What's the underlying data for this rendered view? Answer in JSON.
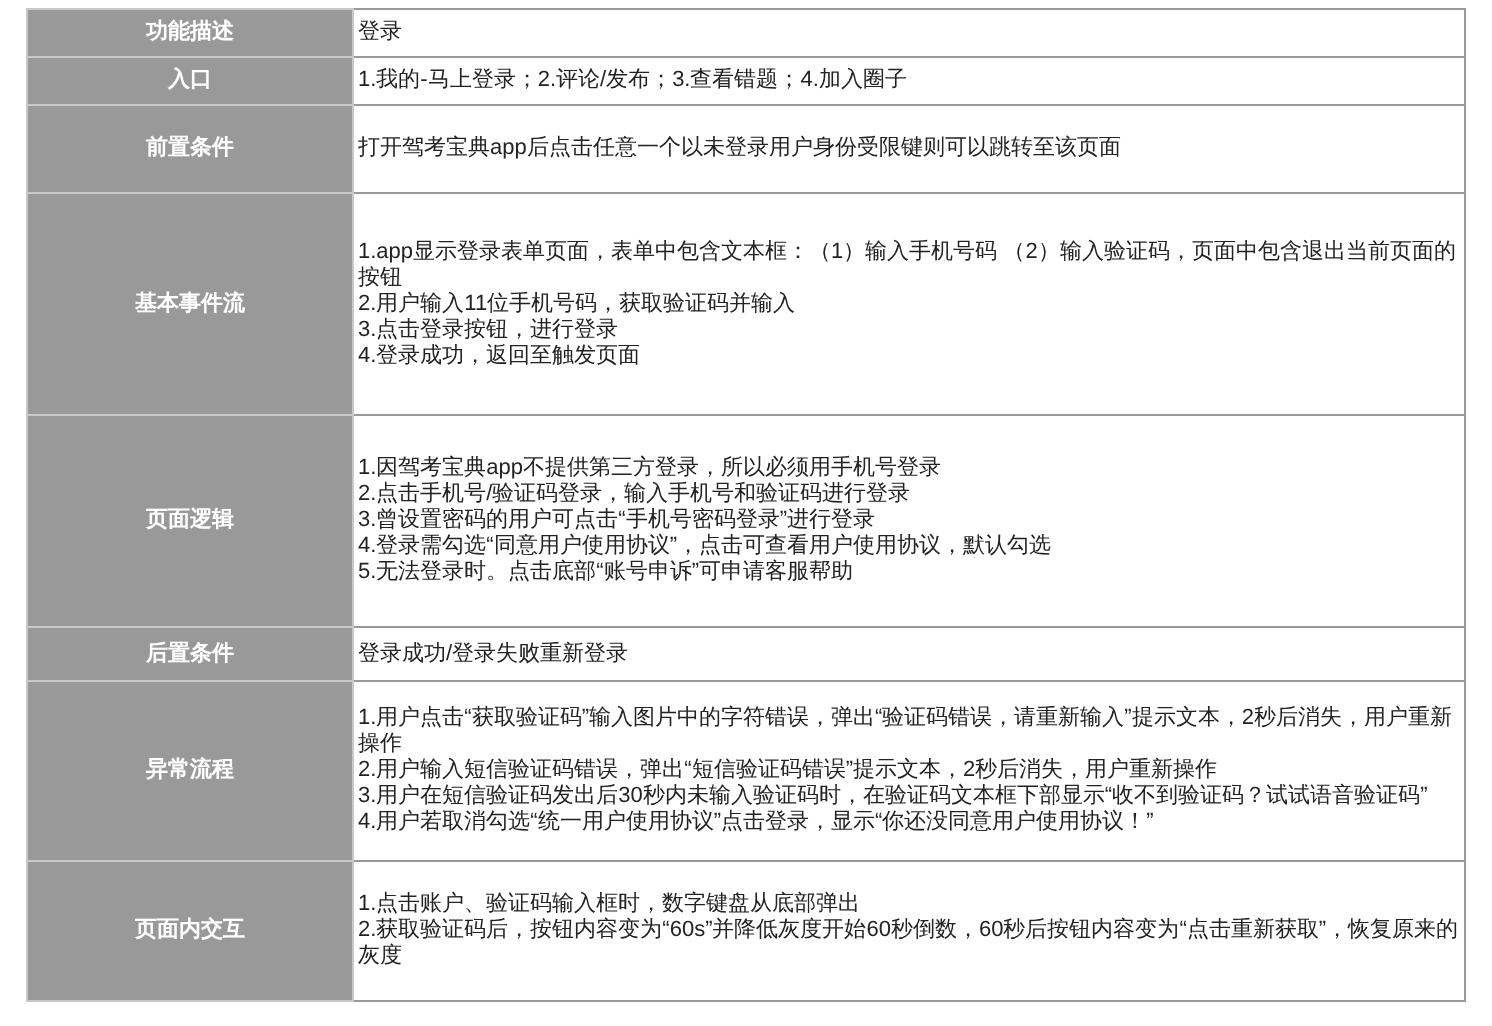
{
  "rows": [
    {
      "label": "功能描述",
      "lines": [
        "登录"
      ]
    },
    {
      "label": "入口",
      "lines": [
        "1.我的-马上登录；2.评论/发布；3.查看错题；4.加入圈子"
      ]
    },
    {
      "label": "前置条件",
      "lines": [
        "打开驾考宝典app后点击任意一个以未登录用户身份受限键则可以跳转至该页面"
      ]
    },
    {
      "label": "基本事件流",
      "lines": [
        "1.app显示登录表单页面，表单中包含文本框：（1）输入手机号码 （2）输入验证码，页面中包含退出当前页面的按钮",
        "2.用户输入11位手机号码，获取验证码并输入",
        "3.点击登录按钮，进行登录",
        "4.登录成功，返回至触发页面"
      ]
    },
    {
      "label": "页面逻辑",
      "lines": [
        "1.因驾考宝典app不提供第三方登录，所以必须用手机号登录",
        "2.点击手机号/验证码登录，输入手机号和验证码进行登录",
        "3.曾设置密码的用户可点击“手机号密码登录”进行登录",
        "4.登录需勾选“同意用户使用协议”，点击可查看用户使用协议，默认勾选",
        "5.无法登录时。点击底部“账号申诉”可申请客服帮助"
      ]
    },
    {
      "label": "后置条件",
      "lines": [
        "登录成功/登录失败重新登录"
      ]
    },
    {
      "label": "异常流程",
      "lines": [
        "1.用户点击“获取验证码”输入图片中的字符错误，弹出“验证码错误，请重新输入”提示文本，2秒后消失，用户重新操作",
        "2.用户输入短信验证码错误，弹出“短信验证码错误”提示文本，2秒后消失，用户重新操作",
        "3.用户在短信验证码发出后30秒内未输入验证码时，在验证码文本框下部显示“收不到验证码？试试语音验证码”",
        "4.用户若取消勾选“统一用户使用协议”点击登录，显示“你还没同意用户使用协议！”"
      ]
    },
    {
      "label": "页面内交互",
      "lines": [
        "1.点击账户、验证码输入框时，数字键盘从底部弹出",
        "2.获取验证码后，按钮内容变为“60s”并降低灰度开始60秒倒数，60秒后按钮内容变为“点击重新获取”，恢复原来的灰度"
      ]
    }
  ]
}
